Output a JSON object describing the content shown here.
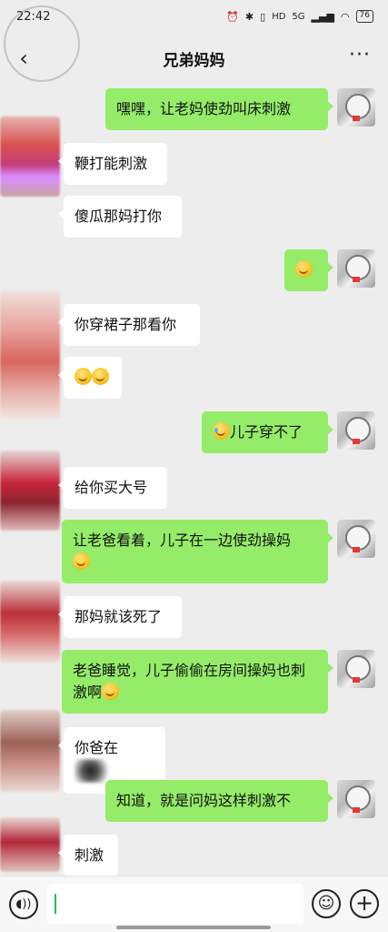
{
  "status_bar": {
    "time": "22:42",
    "signal": "5G",
    "hd": "HD",
    "battery": "76"
  },
  "watermark": "",
  "header": {
    "back_icon": "chevron-left-icon",
    "title": "兄弟妈妈",
    "more_label": "···"
  },
  "messages": [
    {
      "side": "right",
      "text": "嘿嘿，让老妈使劲叫床刺激"
    },
    {
      "side": "left",
      "text": "鞭打能刺激"
    },
    {
      "side": "left",
      "text": "傻瓜那妈打你"
    },
    {
      "side": "right",
      "text": "",
      "emoji": "grinning-face-emoji"
    },
    {
      "side": "left",
      "text": "你穿裙子那看你"
    },
    {
      "side": "left",
      "text": "",
      "emoji": "grinning-face-emoji-x2"
    },
    {
      "side": "right",
      "text": "儿子穿不了",
      "emoji": "crying-laughing-emoji"
    },
    {
      "side": "left",
      "text": "给你买大号"
    },
    {
      "side": "right",
      "text": "让老爸看着，儿子在一边使劲操妈",
      "emoji": "grinning-face-emoji"
    },
    {
      "side": "left",
      "text": "那妈就该死了"
    },
    {
      "side": "right",
      "text": "老爸睡觉，儿子偷偷在房间操妈也刺激啊",
      "emoji": "grinning-face-emoji"
    },
    {
      "side": "left",
      "text": "你爸在",
      "redacted": true
    },
    {
      "side": "right",
      "text": "知道，就是问妈这样刺激不"
    },
    {
      "side": "left",
      "text": "刺激"
    }
  ],
  "input_bar": {
    "voice_icon": "voice-icon",
    "emoji_icon": "smile-icon",
    "plus_icon": "plus-icon",
    "input_value": ""
  },
  "colors": {
    "background": "#ededed",
    "self_bubble": "#95ec69",
    "other_bubble": "#ffffff"
  }
}
